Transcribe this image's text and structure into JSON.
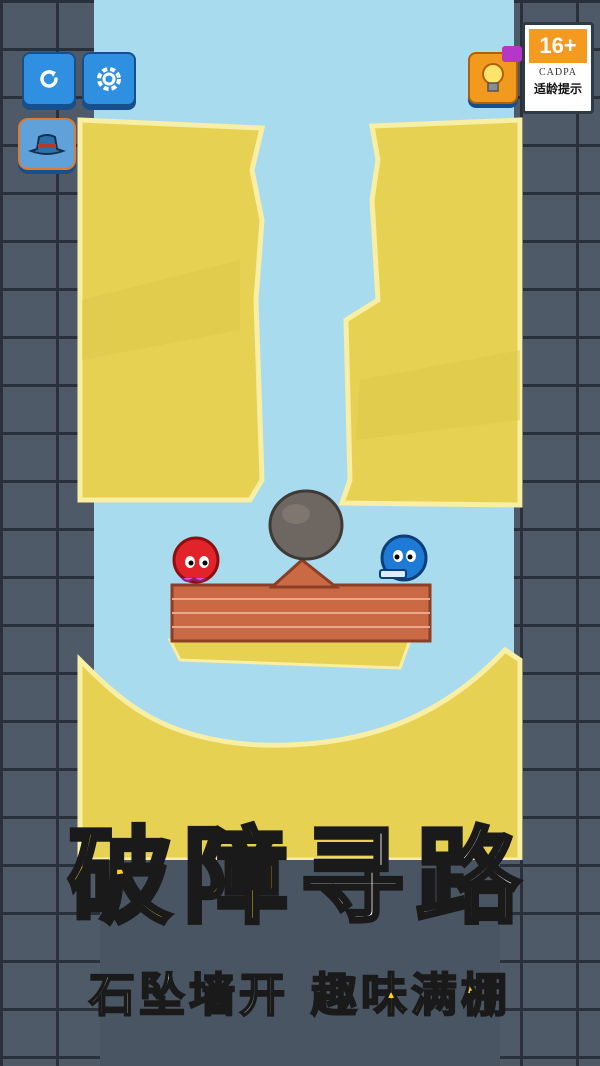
{
  "toolbar": {
    "restart_icon": "restart-icon",
    "settings_icon": "gear-icon",
    "hat_icon": "hat-icon",
    "hint_icon": "lightbulb-icon",
    "video_icon": "video-icon"
  },
  "age_rating": {
    "rating": "16+",
    "org": "CADPA",
    "label": "适龄提示"
  },
  "characters": {
    "red": "red-ball-character",
    "blue": "blue-ball-character",
    "boulder": "boulder"
  },
  "headline": {
    "part1": "破障",
    "part2": "寻路"
  },
  "subline": {
    "part1": "石坠墙开",
    "part2": "趣味满棚"
  },
  "colors": {
    "sand": "#e7d152",
    "sky": "#a9dbef",
    "wall": "#4f5a68",
    "accent_yellow": "#ffd21a",
    "button_blue": "#2f8fe0"
  }
}
